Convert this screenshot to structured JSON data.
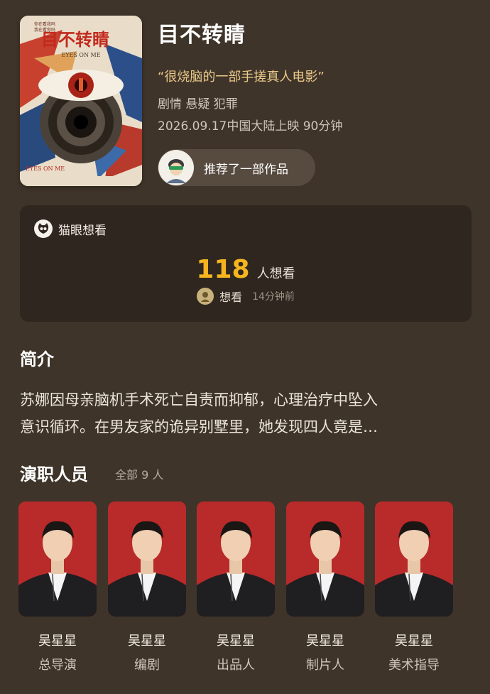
{
  "movie": {
    "title": "目不转睛",
    "quote": "“很烧脑的一部手搓真人电影”",
    "genres": "剧情 悬疑 犯罪",
    "release": "2026.09.17中国大陆上映 90分钟",
    "recommend_label": "推荐了一部作品",
    "poster": {
      "title_cn": "目不转睛",
      "title_en": "EYES ON ME",
      "corner_en": "EYES ON ME",
      "top_text_1": "你在看我吗",
      "top_text_2": "我在看你吗"
    }
  },
  "wish": {
    "source_label": "猫眼想看",
    "count": "118",
    "unit": "人想看",
    "recent_action": "想看",
    "recent_time": "14分钟前"
  },
  "synopsis": {
    "heading": "简介",
    "line1": "苏娜因母亲脑机手术死亡自责而抑郁，心理治疗中坠入",
    "line2": "意识循环。在男友家的诡异别墅里，她发现四人竟是…"
  },
  "cast": {
    "heading": "演职人员",
    "all_label": "全部 9 人",
    "members": [
      {
        "name": "吴星星",
        "role": "总导演"
      },
      {
        "name": "吴星星",
        "role": "编剧"
      },
      {
        "name": "吴星星",
        "role": "出品人"
      },
      {
        "name": "吴星星",
        "role": "制片人"
      },
      {
        "name": "吴星星",
        "role": "美术指导"
      }
    ]
  },
  "icons": {
    "cat": "maoyan-cat-icon",
    "avatar": "user-avatar"
  },
  "colors": {
    "background": "#3f3429",
    "card": "#2f271f",
    "accent_number": "#f6b51e",
    "quote": "#e9c98a",
    "cast_bg": "#b92a2a"
  }
}
